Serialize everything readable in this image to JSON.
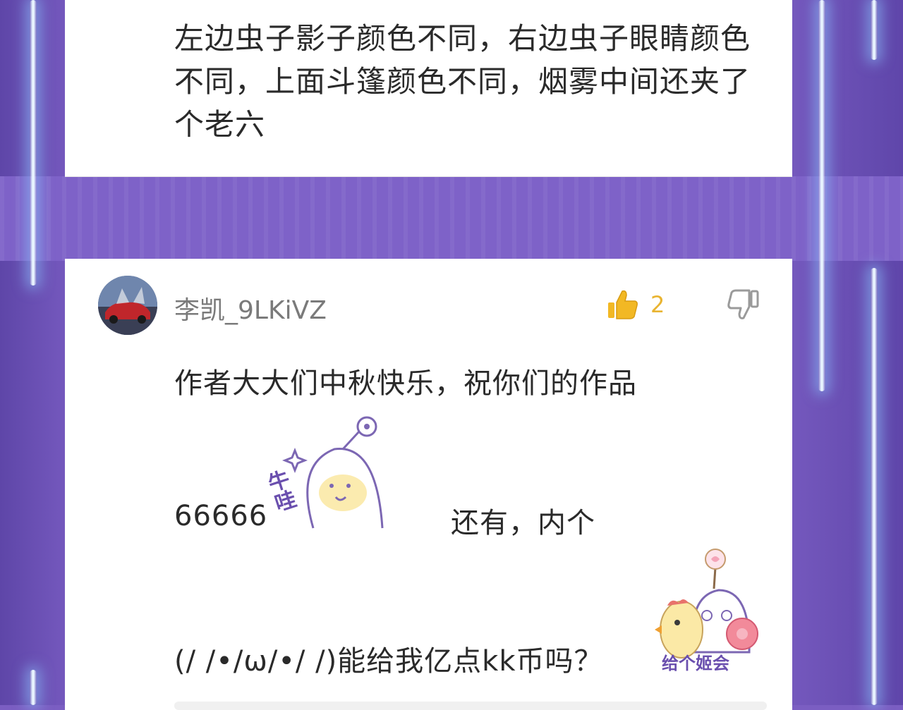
{
  "previous_comment": {
    "text": "左边虫子影子颜色不同，右边虫子眼睛颜色不同，上面斗篷颜色不同，烟雾中间还夹了个老六"
  },
  "comment": {
    "username": "李凯_9LKiVZ",
    "like_count": "2",
    "line1": "作者大大们中秋快乐，祝你们的作品",
    "line2_prefix": "66666",
    "sticker1_text": "牛哇",
    "line2_suffix": "还有，内个",
    "line3": "(/ /•/ω/•/ /)能给我亿点kk币吗？",
    "sticker2_text": "给个姬会"
  },
  "icons": {
    "like": "thumbs-up-icon",
    "dislike": "thumbs-down-icon"
  },
  "colors": {
    "like_accent": "#e9b431",
    "background": "#7559be"
  }
}
